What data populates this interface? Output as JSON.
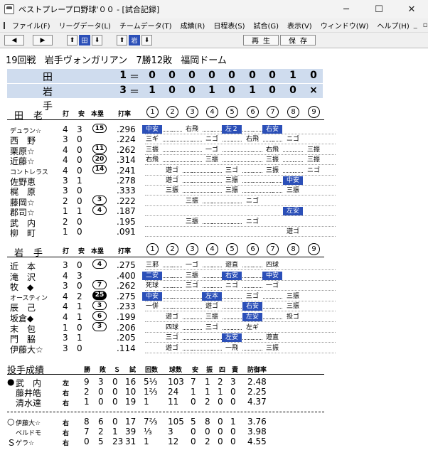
{
  "window": {
    "title": "ベストプレープロ野球'００ - [試合記録]",
    "min": "─",
    "max": "☐",
    "close": "✕"
  },
  "menu": [
    "ファイル(F)",
    "リーグデータ(L)",
    "チームデータ(T)",
    "成績(R)",
    "日程表(S)",
    "試合(G)",
    "表示(V)",
    "ウィンドウ(W)",
    "ヘルプ(H)"
  ],
  "mdi": [
    "_",
    "▫",
    "×"
  ],
  "toolbar": {
    "left": "◀",
    "right": "▶",
    "up": "⬆",
    "tigers": "田",
    "down": "⬇",
    "up2": "⬆",
    "iwate": "岩",
    "down2": "⬇",
    "play": "再生",
    "save": "保存"
  },
  "header": {
    "round": "19回戦",
    "team": "岩手ヴォンガリアン",
    "record": "7勝12敗",
    "stadium": "福岡ドーム"
  },
  "scoreboard": [
    {
      "team": "田老",
      "total": "1",
      "eq": "＝",
      "innings": [
        "0",
        "0",
        "0",
        "0",
        "0",
        "0",
        "0",
        "1",
        "0"
      ]
    },
    {
      "team": "岩手",
      "total": "3",
      "eq": "＝",
      "innings": [
        "1",
        "0",
        "0",
        "1",
        "0",
        "1",
        "0",
        "0",
        "×"
      ]
    }
  ],
  "columns": {
    "ab": "打",
    "h": "安",
    "hr": "本塁",
    "avg": "打率",
    "inn": [
      "1",
      "2",
      "3",
      "4",
      "5",
      "6",
      "7",
      "8",
      "9"
    ]
  },
  "away": {
    "team": "田老",
    "players": [
      {
        "name": "デュラン☆",
        "ab": "4",
        "h": "3",
        "hr": "15",
        "avg": ".296",
        "res": [
          [
            "中安",
            1
          ],
          "",
          "右飛",
          "",
          [
            "左２",
            1
          ],
          "",
          [
            "右安",
            1
          ],
          "",
          ""
        ]
      },
      {
        "name": "西　野",
        "ab": "3",
        "h": "0",
        "hr": "",
        "avg": ".224",
        "res": [
          "三ギ",
          "",
          "",
          "ニゴ",
          "",
          "右飛",
          "",
          "ニゴ",
          ""
        ]
      },
      {
        "name": "栗原☆",
        "ab": "4",
        "h": "0",
        "hr": "11",
        "avg": ".262",
        "res": [
          "三振",
          "",
          "",
          "一ゴ",
          "",
          "",
          "右飛",
          "",
          "三振"
        ]
      },
      {
        "name": "近藤☆",
        "ab": "4",
        "h": "0",
        "hr": "20",
        "avg": ".314",
        "res": [
          "右飛",
          "",
          "",
          "三振",
          "",
          "",
          "三振",
          "",
          "三振"
        ]
      },
      {
        "name": "コントレラス",
        "ab": "4",
        "h": "0",
        "hr": "14",
        "avg": ".241",
        "res": [
          "",
          "遊ゴ",
          "",
          "",
          "三ゴ",
          "",
          "三振",
          "",
          "ニゴ"
        ]
      },
      {
        "name": "佐野恵",
        "ab": "3",
        "h": "1",
        "hr": "",
        "avg": ".278",
        "res": [
          "",
          "遊ゴ",
          "",
          "",
          "三振",
          "",
          "",
          [
            "中安",
            1
          ],
          ""
        ]
      },
      {
        "name": "梶　原",
        "ab": "3",
        "h": "0",
        "hr": "",
        "avg": ".333",
        "res": [
          "",
          "三振",
          "",
          "",
          "三振",
          "",
          "",
          "三振",
          ""
        ]
      },
      {
        "name": "藤岡☆",
        "ab": "2",
        "h": "0",
        "hr": "3",
        "avg": ".222",
        "res": [
          "",
          "",
          "三振",
          "",
          "",
          "ニゴ",
          "",
          "",
          ""
        ]
      },
      {
        "name": "郡司☆",
        "ab": "1",
        "h": "1",
        "hr": "4",
        "avg": ".187",
        "res": [
          "",
          "",
          "",
          "",
          "",
          "",
          "",
          [
            "左安",
            1
          ],
          ""
        ]
      },
      {
        "name": "武　内",
        "ab": "2",
        "h": "0",
        "hr": "",
        "avg": ".195",
        "res": [
          "",
          "",
          "三振",
          "",
          "",
          "ニゴ",
          "",
          "",
          ""
        ]
      },
      {
        "name": "柳　町",
        "ab": "1",
        "h": "0",
        "hr": "",
        "avg": ".091",
        "res": [
          "",
          "",
          "",
          "",
          "",
          "",
          "",
          "遊ゴ",
          ""
        ]
      }
    ]
  },
  "home": {
    "team": "岩手",
    "players": [
      {
        "name": "近　本",
        "ab": "3",
        "h": "0",
        "hr": "4",
        "avg": ".275",
        "res": [
          "三邪",
          "",
          "一ゴ",
          "",
          "遊直",
          "",
          "四球",
          "",
          ""
        ]
      },
      {
        "name": "滝　沢",
        "ab": "4",
        "h": "3",
        "hr": "",
        "avg": ".400",
        "res": [
          [
            "二安",
            1
          ],
          "",
          "三振",
          "",
          [
            "右安",
            1
          ],
          "",
          [
            "中安",
            1
          ],
          "",
          ""
        ]
      },
      {
        "name": "牧　◆",
        "ab": "3",
        "h": "0",
        "hr": "7",
        "avg": ".262",
        "res": [
          "死球",
          "",
          "三ゴ",
          "",
          "ニゴ",
          "",
          "一ゴ",
          "",
          ""
        ]
      },
      {
        "name": "オースティン",
        "ab": "4",
        "h": "2",
        "hr": "25",
        "avg": ".275",
        "res": [
          [
            "中安",
            1
          ],
          "",
          "",
          [
            "左本",
            1
          ],
          "",
          "三ゴ",
          "",
          "三振",
          ""
        ]
      },
      {
        "name": "辰　己",
        "ab": "4",
        "h": "1",
        "hr": "3",
        "avg": ".233",
        "res": [
          "一併",
          "",
          "",
          "遊ゴ",
          "",
          [
            "右安",
            1
          ],
          "",
          "三振",
          ""
        ]
      },
      {
        "name": "坂倉◆",
        "ab": "4",
        "h": "1",
        "hr": "6",
        "avg": ".199",
        "res": [
          "",
          "遊ゴ",
          "",
          "三振",
          "",
          [
            "左安",
            1
          ],
          "",
          "投ゴ",
          ""
        ]
      },
      {
        "name": "末　包",
        "ab": "1",
        "h": "0",
        "hr": "3",
        "avg": ".206",
        "res": [
          "",
          "四球",
          "",
          "三ゴ",
          "",
          "左ギ",
          "",
          "",
          ""
        ]
      },
      {
        "name": "門　脇",
        "ab": "3",
        "h": "1",
        "hr": "",
        "avg": ".205",
        "res": [
          "",
          "三ゴ",
          "",
          "",
          [
            "左安",
            1
          ],
          "",
          "遊直",
          "",
          ""
        ]
      },
      {
        "name": "伊藤大☆",
        "ab": "3",
        "h": "0",
        "hr": "",
        "avg": ".114",
        "res": [
          "",
          "遊ゴ",
          "",
          "",
          "一飛",
          "",
          "三振",
          "",
          ""
        ]
      }
    ]
  },
  "pitching": {
    "title": "投手成績",
    "headers": [
      "勝",
      "敗",
      "Ｓ",
      "試",
      "回数",
      "球数",
      "安",
      "振",
      "四",
      "責",
      "防御率"
    ],
    "away": [
      {
        "mark": "●",
        "name": "武　内",
        "hand": "左",
        "w": "9",
        "l": "3",
        "s": "0",
        "g": "16",
        "ip": "5⅓",
        "pc": "103",
        "h": "7",
        "k": "1",
        "bb": "2",
        "er": "3",
        "era": "2.48"
      },
      {
        "mark": "",
        "name": "藤井皓",
        "hand": "右",
        "w": "2",
        "l": "0",
        "s": "0",
        "g": "10",
        "ip": "1⅔",
        "pc": "24",
        "h": "1",
        "k": "1",
        "bb": "1",
        "er": "0",
        "era": "2.25"
      },
      {
        "mark": "",
        "name": "清水達",
        "hand": "右",
        "w": "1",
        "l": "0",
        "s": "0",
        "g": "19",
        "ip": "1",
        "pc": "11",
        "h": "0",
        "k": "2",
        "bb": "0",
        "er": "0",
        "era": "4.37"
      }
    ],
    "home": [
      {
        "mark": "○",
        "name": "伊藤大☆",
        "hand": "右",
        "w": "8",
        "l": "6",
        "s": "0",
        "g": "17",
        "ip": "7⅔",
        "pc": "105",
        "h": "5",
        "k": "8",
        "bb": "0",
        "er": "1",
        "era": "3.76"
      },
      {
        "mark": "",
        "name": "ベルドモ",
        "hand": "右",
        "w": "7",
        "l": "2",
        "s": "1",
        "g": "39",
        "ip": "⅓",
        "pc": "3",
        "h": "0",
        "k": "0",
        "bb": "0",
        "er": "0",
        "era": "3.98"
      },
      {
        "mark": "Ｓ",
        "name": "ゲラ☆",
        "hand": "右",
        "w": "0",
        "l": "5",
        "s": "23",
        "g": "31",
        "ip": "1",
        "pc": "12",
        "h": "0",
        "k": "2",
        "bb": "0",
        "er": "0",
        "era": "4.55"
      }
    ]
  }
}
